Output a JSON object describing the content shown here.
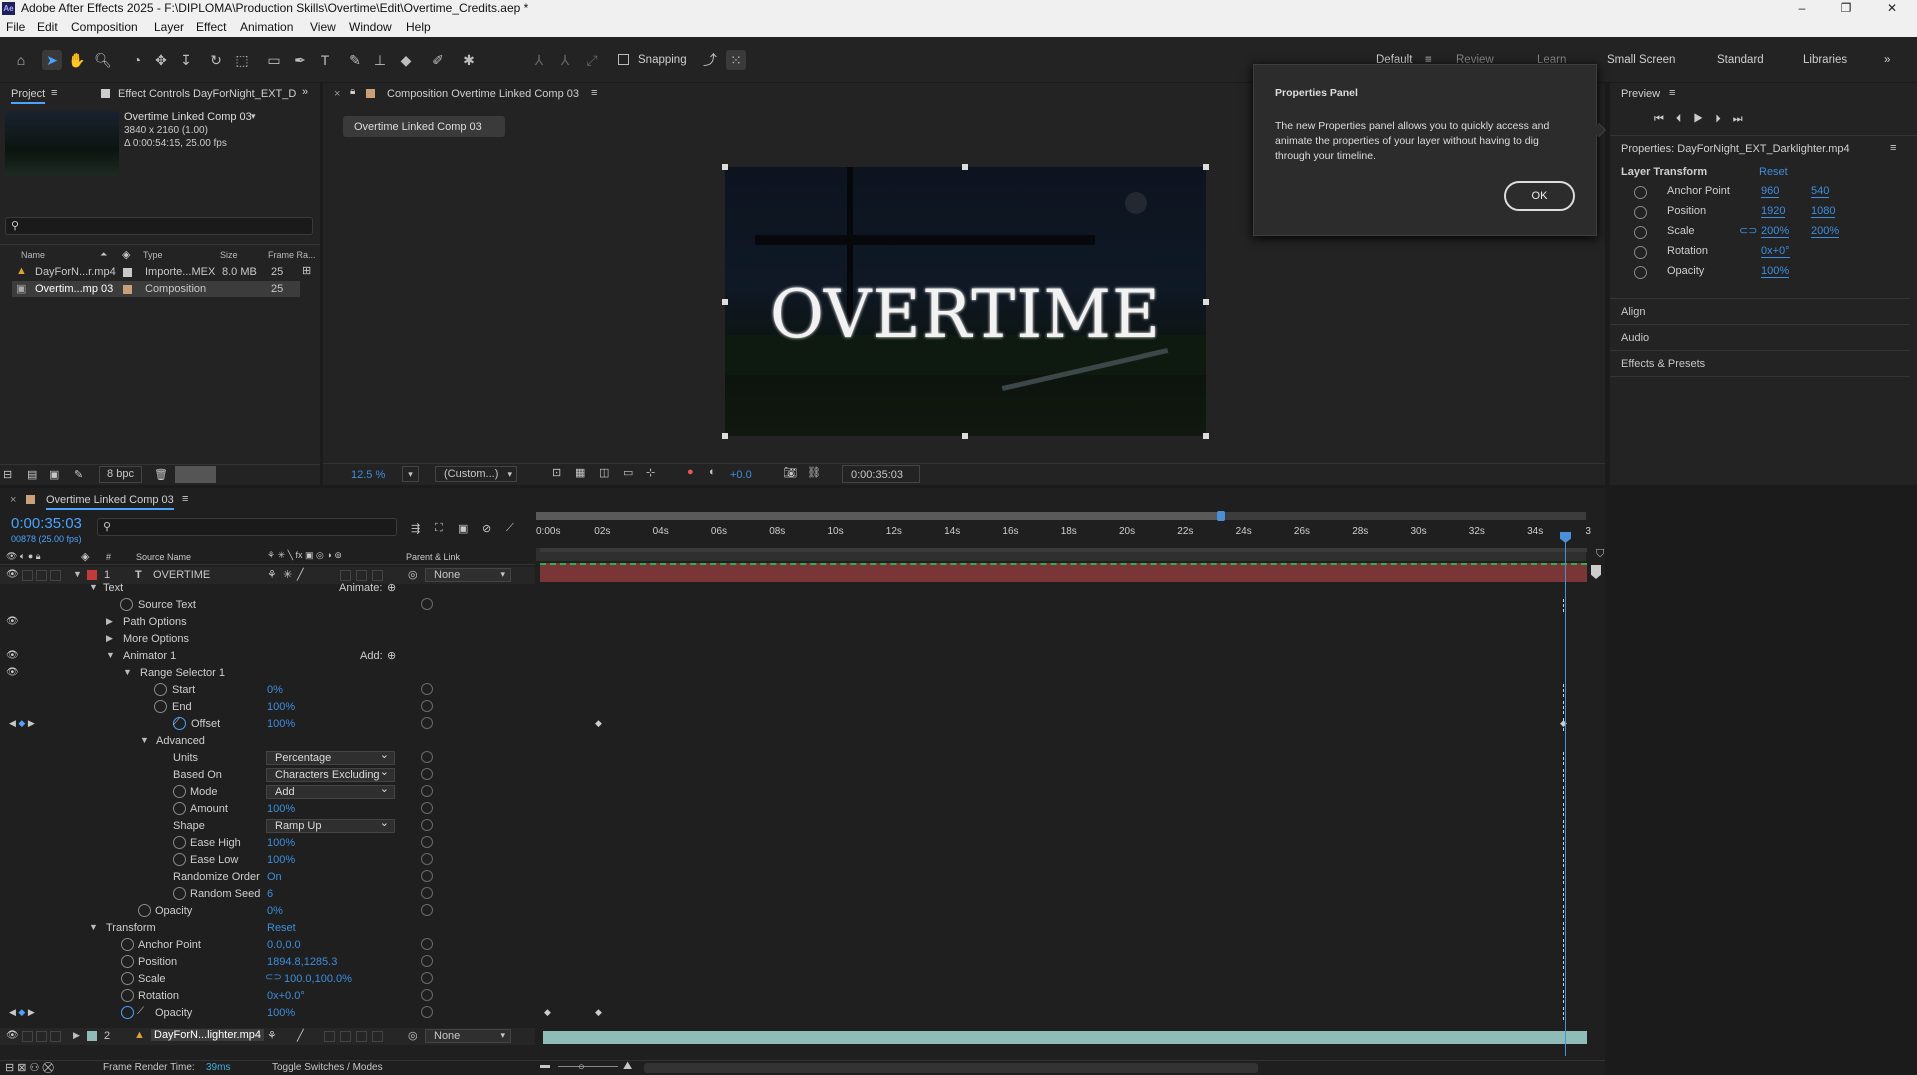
{
  "app": {
    "title": "Adobe After Effects 2025 - F:\\DIPLOMA\\Production Skills\\Overtime\\Edit\\Overtime_Credits.aep *",
    "logo_text": "Ae"
  },
  "menu": [
    "File",
    "Edit",
    "Composition",
    "Layer",
    "Effect",
    "Animation",
    "View",
    "Window",
    "Help"
  ],
  "toolbar": {
    "snapping_label": "Snapping",
    "workspaces": [
      "Default",
      "Review",
      "Learn",
      "Small Screen",
      "Standard",
      "Libraries"
    ]
  },
  "project": {
    "tab_label": "Project",
    "effect_controls_label": "Effect Controls DayForNight_EXT_Da",
    "selected_name": "Overtime Linked Comp 03",
    "selected_dims": "3840 x 2160 (1.00)",
    "selected_duration": "Δ 0:00:54:15, 25.00 fps",
    "search_placeholder": "",
    "columns": [
      "Name",
      "Type",
      "Size",
      "Frame Ra..."
    ],
    "items": [
      {
        "name": "DayForN...r.mp4",
        "type": "Importe...MEX",
        "size": "8.0 MB",
        "fps": "25"
      },
      {
        "name": "Overtim...mp 03",
        "type": "Composition",
        "size": "",
        "fps": "25"
      }
    ],
    "bpc": "8 bpc"
  },
  "composition": {
    "tab_label": "Composition Overtime Linked Comp 03",
    "crumb": "Overtime Linked Comp 03",
    "title_text": "OVERTIME",
    "zoom": "12.5 %",
    "resolution": "(Custom...)",
    "exposure": "+0.0",
    "timecode": "0:00:35:03"
  },
  "properties_popup": {
    "title": "Properties Panel",
    "body": "The new Properties panel allows you to quickly access and animate the properties of your layer without having to dig through your timeline.",
    "ok": "OK"
  },
  "right_panel": {
    "preview_label": "Preview",
    "properties_label": "Properties: DayForNight_EXT_Darklighter.mp4",
    "layer_transform": "Layer Transform",
    "reset": "Reset",
    "props": [
      {
        "name": "Anchor Point",
        "v1": "960",
        "v2": "540"
      },
      {
        "name": "Position",
        "v1": "1920",
        "v2": "1080"
      },
      {
        "name": "Scale",
        "v1": "200%",
        "v2": "200%"
      },
      {
        "name": "Rotation",
        "v1": "0x+0°",
        "v2": ""
      },
      {
        "name": "Opacity",
        "v1": "100%",
        "v2": ""
      }
    ],
    "sections": [
      "Align",
      "Audio",
      "Effects & Presets"
    ]
  },
  "timeline": {
    "tab_label": "Overtime Linked Comp 03",
    "timecode": "0:00:35:03",
    "frame_info": "00878 (25.00 fps)",
    "col_source": "Source Name",
    "col_parent": "Parent & Link",
    "ruler": [
      "0:00s",
      "02s",
      "04s",
      "06s",
      "08s",
      "10s",
      "12s",
      "14s",
      "16s",
      "18s",
      "20s",
      "22s",
      "24s",
      "26s",
      "28s",
      "30s",
      "32s",
      "34s",
      "3"
    ],
    "layer1": {
      "num": "1",
      "name": "OVERTIME",
      "parent": "None"
    },
    "layer2": {
      "num": "2",
      "name": "DayForN...lighter.mp4",
      "parent": "None"
    },
    "rows": {
      "text": "Text",
      "animate": "Animate:",
      "source_text": "Source Text",
      "path_options": "Path Options",
      "more_options": "More Options",
      "animator": "Animator 1",
      "add": "Add:",
      "range": "Range Selector 1",
      "start": "Start",
      "start_v": "0%",
      "end": "End",
      "end_v": "100%",
      "offset": "Offset",
      "offset_v": "100%",
      "advanced": "Advanced",
      "units": "Units",
      "units_v": "Percentage",
      "based": "Based On",
      "based_v": "Characters Excluding",
      "mode": "Mode",
      "mode_v": "Add",
      "amount": "Amount",
      "amount_v": "100%",
      "shape": "Shape",
      "shape_v": "Ramp Up",
      "ease_high": "Ease High",
      "ease_high_v": "100%",
      "ease_low": "Ease Low",
      "ease_low_v": "100%",
      "rand_order": "Randomize Order",
      "rand_order_v": "On",
      "rand_seed": "Random Seed",
      "rand_seed_v": "6",
      "opacity_a": "Opacity",
      "opacity_a_v": "0%",
      "transform": "Transform",
      "transform_reset": "Reset",
      "anchor": "Anchor Point",
      "anchor_v": "0.0,0.0",
      "position": "Position",
      "position_v": "1894.8,1285.3",
      "scale": "Scale",
      "scale_v": "100.0,100.0%",
      "rotation": "Rotation",
      "rotation_v": "0x+0.0°",
      "opacity": "Opacity",
      "opacity_v": "100%"
    },
    "footer_render": "Frame Render Time:",
    "footer_render_v": "39ms",
    "footer_toggle": "Toggle Switches / Modes"
  }
}
